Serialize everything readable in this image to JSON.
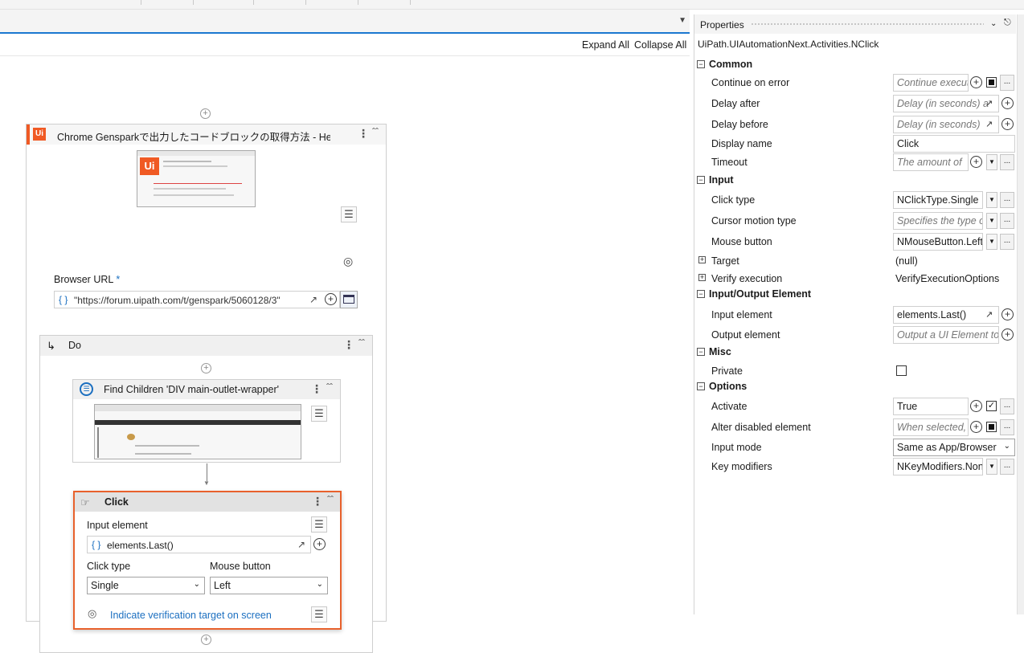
{
  "designer": {
    "expand_all": "Expand All",
    "collapse_all": "Collapse All",
    "browser_scope": {
      "title": "Chrome Gensparkで出力したコードブロックの取得方法 - Help  Solu",
      "logo_text": "Ui",
      "url_label": "Browser URL",
      "required_mark": "*",
      "url_value": "\"https://forum.uipath.com/t/genspark/5060128/3\""
    },
    "do_block": {
      "title": "Do"
    },
    "find_children": {
      "title": "Find Children 'DIV  main-outlet-wrapper'"
    },
    "click": {
      "title": "Click",
      "input_element_label": "Input element",
      "input_element_value": "elements.Last()",
      "click_type_label": "Click type",
      "click_type_value": "Single",
      "mouse_button_label": "Mouse button",
      "mouse_button_value": "Left",
      "verify_link": "Indicate verification target on screen"
    }
  },
  "properties": {
    "title": "Properties",
    "class_name": "UiPath.UIAutomationNext.Activities.NClick",
    "categories": {
      "common": "Common",
      "input": "Input",
      "io_element": "Input/Output Element",
      "misc": "Misc",
      "options": "Options"
    },
    "rows": {
      "continue_on_error": {
        "name": "Continue on error",
        "placeholder": "Continue executi"
      },
      "delay_after": {
        "name": "Delay after",
        "placeholder": "Delay (in seconds) a"
      },
      "delay_before": {
        "name": "Delay before",
        "placeholder": "Delay (in seconds)"
      },
      "display_name": {
        "name": "Display name",
        "value": "Click"
      },
      "timeout": {
        "name": "Timeout",
        "placeholder": "The amount of"
      },
      "click_type": {
        "name": "Click type",
        "value": "NClickType.Single"
      },
      "cursor_motion": {
        "name": "Cursor motion type",
        "placeholder": "Specifies the type o"
      },
      "mouse_button": {
        "name": "Mouse button",
        "value": "NMouseButton.Left"
      },
      "target": {
        "name": "Target",
        "value": "(null)"
      },
      "verify_execution": {
        "name": "Verify execution",
        "value": "VerifyExecutionOptions"
      },
      "input_element": {
        "name": "Input element",
        "value": "elements.Last()"
      },
      "output_element": {
        "name": "Output element",
        "placeholder": "Output a UI Element to"
      },
      "private": {
        "name": "Private"
      },
      "activate": {
        "name": "Activate",
        "value": "True"
      },
      "alter_disabled": {
        "name": "Alter disabled element",
        "placeholder": "When selected,"
      },
      "input_mode": {
        "name": "Input mode",
        "value": "Same as App/Browser"
      },
      "key_modifiers": {
        "name": "Key modifiers",
        "value": "NKeyModifiers.None"
      }
    }
  },
  "colors": {
    "accent": "#1b78d0",
    "uipath_orange": "#f05a24",
    "selected_border": "#e8612c",
    "link": "#1b6fc0"
  }
}
